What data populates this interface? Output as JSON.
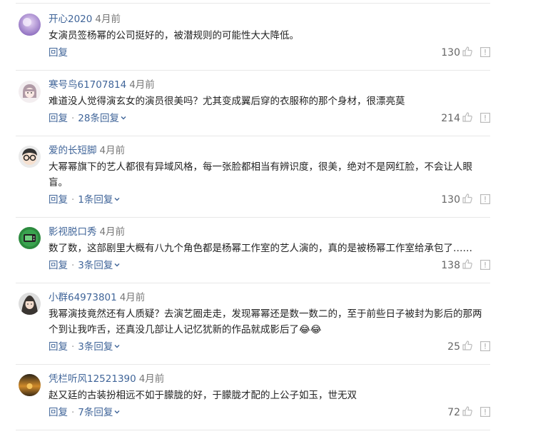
{
  "comments": [
    {
      "username": "开心2020",
      "time": "4月前",
      "text": "女演员签杨幂的公司挺好的，被潜规则的可能性大大降低。",
      "reply_label": "回复",
      "reply_count_label": "",
      "likes": "130",
      "avatar": "purple-blur"
    },
    {
      "username": "寒号鸟61707814",
      "time": "4月前",
      "text": "难道没人觉得演玄女的演员很美吗？尤其变成翼后穿的衣服称的那个身材，很漂亮莫",
      "reply_label": "回复",
      "reply_count_label": "28条回复",
      "likes": "214",
      "avatar": "anime-girl"
    },
    {
      "username": "爱的长短脚",
      "time": "4月前",
      "text": "大幂幂旗下的艺人都很有异域风格，每一张脸都相当有辨识度，很美，绝对不是网红脸，不会让人眼盲。",
      "reply_label": "回复",
      "reply_count_label": "1条回复",
      "likes": "130",
      "avatar": "glasses-face"
    },
    {
      "username": "影视脱口秀",
      "time": "4月前",
      "text": "数了数，这部剧里大概有八九个角色都是杨幂工作室的艺人演的，真的是被杨幂工作室给承包了……",
      "reply_label": "回复",
      "reply_count_label": "3条回复",
      "likes": "138",
      "avatar": "tv-logo"
    },
    {
      "username": "小群64973801",
      "time": "4月前",
      "text": "我幂演技竟然还有人质疑？去演艺圈走走，发现幂幂还是数一数二的，至于前些日子被封为影后的那两个到让我咋舌，还真没几部让人记忆犹新的作品就成影后了😂😂",
      "reply_label": "回复",
      "reply_count_label": "3条回复",
      "likes": "25",
      "avatar": "girl-face"
    },
    {
      "username": "凭栏听风12521390",
      "time": "4月前",
      "text": "赵又廷的古装扮相远不如于朦胧的好，于朦胧才配的上公子如玉，世无双",
      "reply_label": "回复",
      "reply_count_label": "7条回复",
      "likes": "72",
      "avatar": "sunset"
    }
  ],
  "colors": {
    "username": "#406599",
    "action": "#406599",
    "count": "#666666",
    "divider": "#e8e8e8"
  },
  "icons": {
    "like": "thumbs-up-icon",
    "report": "exclamation-box-icon",
    "expand": "chevron-down-icon"
  }
}
